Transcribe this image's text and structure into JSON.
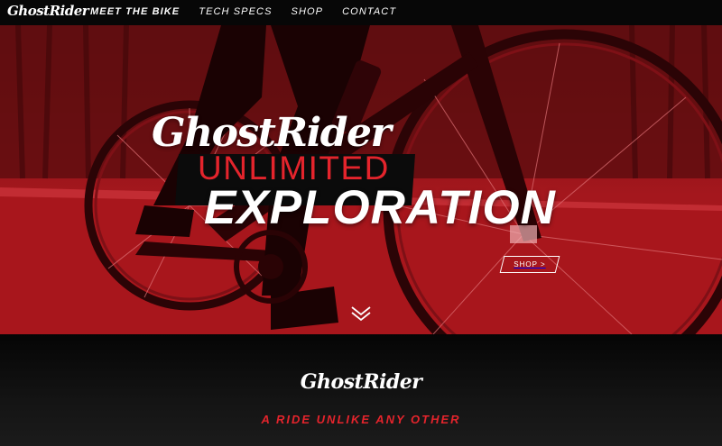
{
  "brand": {
    "logo": "GhostRider"
  },
  "nav": {
    "items": [
      {
        "label": "MEET THE BIKE",
        "active": true
      },
      {
        "label": "TECH SPECS",
        "active": false
      },
      {
        "label": "SHOP",
        "active": false
      },
      {
        "label": "CONTACT",
        "active": false
      }
    ]
  },
  "hero": {
    "logo": "GhostRider",
    "subtitle": "UNLIMITED",
    "title": "EXPLORATION",
    "shop_button": "SHOP >",
    "scroll_icon": "double-chevron-down-icon"
  },
  "lower": {
    "logo": "GhostRider",
    "tagline": "A RIDE UNLIKE ANY OTHER"
  },
  "colors": {
    "accent": "#e4242c",
    "tint": "#c41e25",
    "dark": "#070707"
  }
}
